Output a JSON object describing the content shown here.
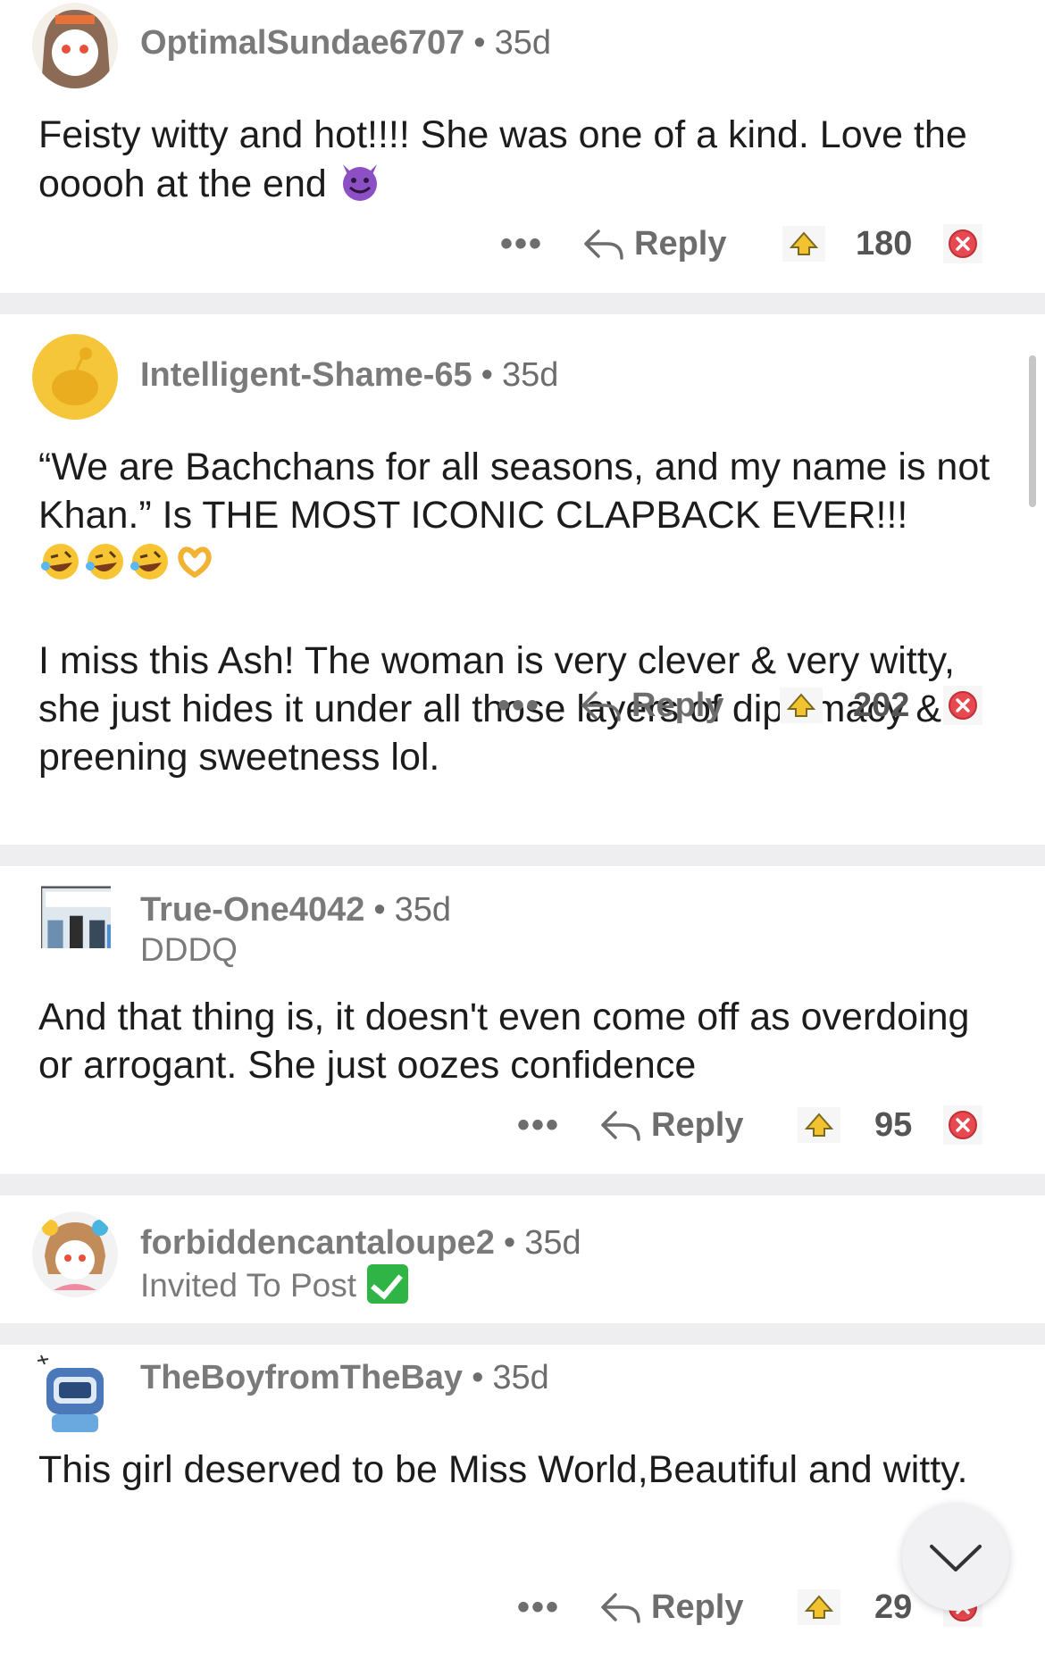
{
  "actions": {
    "more_label": "•••",
    "reply_label": "Reply"
  },
  "comments": [
    {
      "username": "OptimalSundae6707",
      "sep": "•",
      "age": "35d",
      "flair": "",
      "paragraphs": [
        "Feisty witty and hot!!!! She was one of a kind. Love the ooooh at the end"
      ],
      "emoji": [
        "smiling-devil"
      ],
      "score": "180"
    },
    {
      "username": "Intelligent-Shame-65",
      "sep": "•",
      "age": "35d",
      "flair": "",
      "paragraphs": [
        "“We are Bachchans for all seasons, and my name is not Khan.” Is THE MOST ICONIC CLAPBACK EVER!!!",
        "I miss this Ash! The woman is very clever & very witty, she just hides it under all those layers of diplomacy & preening sweetness lol."
      ],
      "emoji": [
        "rolling-laughing",
        "rolling-laughing",
        "rolling-laughing",
        "heart-hands"
      ],
      "score": "202"
    },
    {
      "username": "True-One4042",
      "sep": "•",
      "age": "35d",
      "flair": "DDDQ",
      "paragraphs": [
        "And that thing is, it doesn't even come off as overdoing or arrogant. She just oozes confidence"
      ],
      "emoji": [],
      "score": "95"
    },
    {
      "username": "forbiddencantaloupe2",
      "sep": "•",
      "age": "35d",
      "flair": "Invited To Post",
      "flair_icon": "check-mark-icon",
      "paragraphs": [],
      "emoji": [],
      "score": ""
    },
    {
      "username": "TheBoyfromTheBay",
      "sep": "•",
      "age": "35d",
      "flair": "",
      "paragraphs": [
        "This girl deserved to be Miss World,Beautiful and witty."
      ],
      "emoji": [],
      "score": "29"
    }
  ],
  "colors": {
    "meta": "#6d6d6d",
    "divider": "#eeeef0",
    "flair_check": "#2fb545",
    "downvote": "#e8484f",
    "upvote": "#f2c230"
  }
}
